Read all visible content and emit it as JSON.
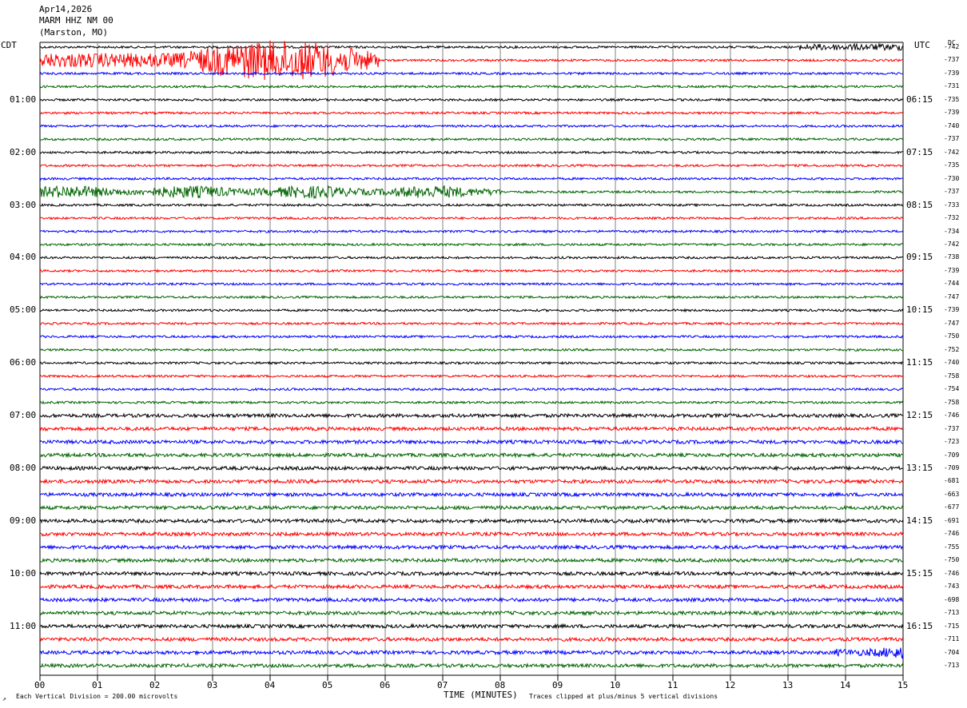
{
  "header": {
    "date": "Apr14,2026",
    "station": "MARM HHZ NM 00",
    "location": "(Marston, MO)"
  },
  "labels": {
    "left_zone": "CDT",
    "right_zone": "UTC",
    "dc_label": "DC",
    "x_axis_title": "TIME (MINUTES)",
    "scale_note": "Each Vertical Division =  200.00 microvolts",
    "clip_note": "Traces clipped at plus/minus 5 vertical divisions",
    "corner_mark": "↗"
  },
  "colors": {
    "trace_cycle": [
      "#000000",
      "#ff0000",
      "#0000ff",
      "#006400"
    ],
    "grid": "#808080"
  },
  "chart_data": {
    "type": "line",
    "subtype": "helicorder",
    "x_range_minutes": [
      0,
      15
    ],
    "x_tick_labels": [
      "00",
      "01",
      "02",
      "03",
      "04",
      "05",
      "06",
      "07",
      "08",
      "09",
      "10",
      "11",
      "12",
      "13",
      "14",
      "15"
    ],
    "minutes_per_line": 15,
    "line_count": 48,
    "grid": true,
    "left_hour_labels": [
      "01:00",
      "02:00",
      "03:00",
      "04:00",
      "05:00",
      "06:00",
      "07:00",
      "08:00",
      "09:00",
      "10:00",
      "11:00"
    ],
    "right_hour_labels": [
      "06:15",
      "07:15",
      "08:15",
      "09:15",
      "10:15",
      "11:15",
      "12:15",
      "13:15",
      "14:15",
      "15:15",
      "16:15"
    ],
    "dc_offsets": [
      -742,
      -737,
      -739,
      -731,
      -735,
      -739,
      -740,
      -737,
      -742,
      -735,
      -730,
      -737,
      -733,
      -732,
      -734,
      -742,
      -738,
      -739,
      -744,
      -747,
      -739,
      -747,
      -750,
      -752,
      -740,
      -758,
      -754,
      -758,
      -746,
      -737,
      -723,
      -709,
      -709,
      -681,
      -663,
      -677,
      -691,
      -746,
      -755,
      -750,
      -746,
      -743,
      -698,
      -713,
      -715,
      -711,
      -704,
      -713
    ],
    "events": [
      {
        "line": 1,
        "start_min": 0.0,
        "end_min": 5.9,
        "amplitude": "clipped"
      },
      {
        "line": 11,
        "start_min": 0.0,
        "end_min": 8.0,
        "amplitude": "high"
      },
      {
        "line": 0,
        "start_min": 13.2,
        "end_min": 15.0,
        "amplitude": "moderate"
      },
      {
        "line": 46,
        "start_min": 13.8,
        "end_min": 15.0,
        "amplitude": "high"
      }
    ]
  }
}
